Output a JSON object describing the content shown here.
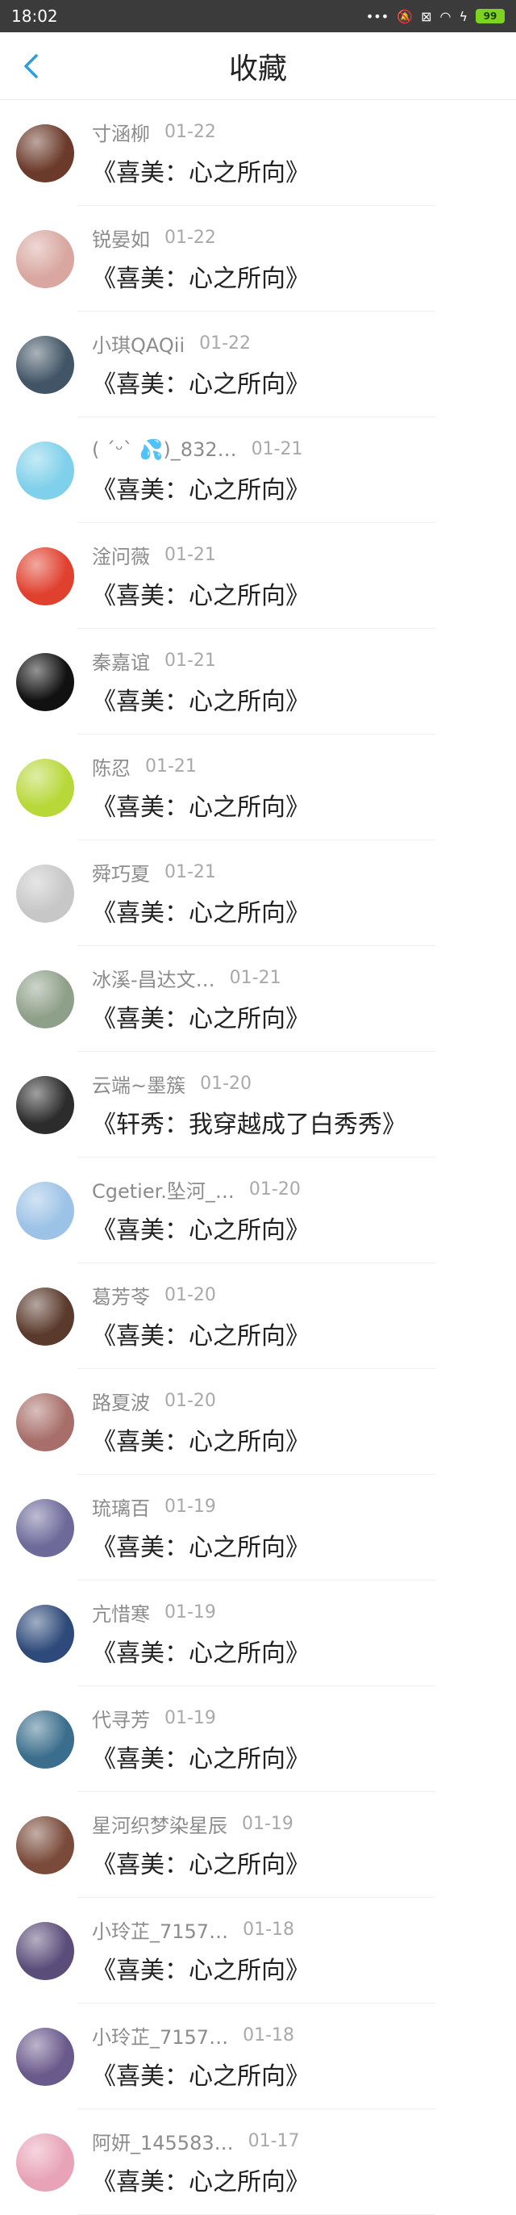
{
  "status_bar": {
    "time": "18:02",
    "icons": [
      "more-dots-icon",
      "mute-bell-icon",
      "sim-icon",
      "wifi-icon",
      "bolt-icon"
    ],
    "battery": "99"
  },
  "header": {
    "title": "收藏",
    "back_icon": "back-chevron-icon",
    "accent": "#2a9fd8"
  },
  "items": [
    {
      "name": "寸涵柳",
      "date": "01-22",
      "book": "《喜美：心之所向》",
      "avatar_color": "#6b3a2a"
    },
    {
      "name": "锐晏如",
      "date": "01-22",
      "book": "《喜美：心之所向》",
      "avatar_color": "#d9a7a0"
    },
    {
      "name": "小琪QAQii",
      "date": "01-22",
      "book": "《喜美：心之所向》",
      "avatar_color": "#415566"
    },
    {
      "name": "( ´ᵕ` 💦)_832…",
      "date": "01-21",
      "book": "《喜美：心之所向》",
      "avatar_color": "#7fd0ea"
    },
    {
      "name": "淦问薇",
      "date": "01-21",
      "book": "《喜美：心之所向》",
      "avatar_color": "#e0402e"
    },
    {
      "name": "秦嘉谊",
      "date": "01-21",
      "book": "《喜美：心之所向》",
      "avatar_color": "#111111"
    },
    {
      "name": "陈忍",
      "date": "01-21",
      "book": "《喜美：心之所向》",
      "avatar_color": "#b8d83a"
    },
    {
      "name": "舜巧夏",
      "date": "01-21",
      "book": "《喜美：心之所向》",
      "avatar_color": "#c7c7c7"
    },
    {
      "name": "冰溪-昌达文…",
      "date": "01-21",
      "book": "《喜美：心之所向》",
      "avatar_color": "#8fa08a"
    },
    {
      "name": "云端~墨簇",
      "date": "01-20",
      "book": "《轩秀：我穿越成了白秀秀》",
      "avatar_color": "#2c2c2c"
    },
    {
      "name": "Cgetier.坠河_…",
      "date": "01-20",
      "book": "《喜美：心之所向》",
      "avatar_color": "#9cc2e6"
    },
    {
      "name": "葛芳苓",
      "date": "01-20",
      "book": "《喜美：心之所向》",
      "avatar_color": "#5a3a2c"
    },
    {
      "name": "路夏波",
      "date": "01-20",
      "book": "《喜美：心之所向》",
      "avatar_color": "#a86f6a"
    },
    {
      "name": "琉璃百",
      "date": "01-19",
      "book": "《喜美：心之所向》",
      "avatar_color": "#6d6a9a"
    },
    {
      "name": "亢惜寒",
      "date": "01-19",
      "book": "《喜美：心之所向》",
      "avatar_color": "#2e4a7a"
    },
    {
      "name": "代寻芳",
      "date": "01-19",
      "book": "《喜美：心之所向》",
      "avatar_color": "#3a6e8c"
    },
    {
      "name": "星河织梦染星辰",
      "date": "01-19",
      "book": "《喜美：心之所向》",
      "avatar_color": "#7a4b3a"
    },
    {
      "name": "小玲芷_7157…",
      "date": "01-18",
      "book": "《喜美：心之所向》",
      "avatar_color": "#5b4d7a"
    },
    {
      "name": "小玲芷_7157…",
      "date": "01-18",
      "book": "《喜美：心之所向》",
      "avatar_color": "#6a5a8c"
    },
    {
      "name": "阿妍_145583…",
      "date": "01-17",
      "book": "《喜美：心之所向》",
      "avatar_color": "#e8a3b8"
    }
  ]
}
